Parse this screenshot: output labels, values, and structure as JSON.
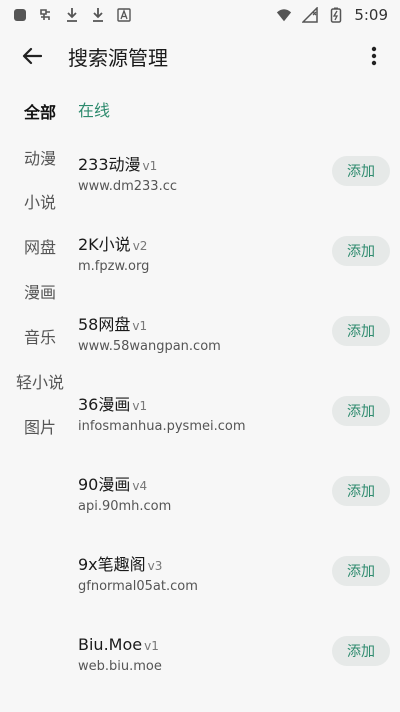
{
  "status_bar": {
    "time": "5:09"
  },
  "header": {
    "title": "搜索源管理"
  },
  "sidebar": {
    "items": [
      {
        "label": "全部",
        "active": true
      },
      {
        "label": "动漫",
        "active": false
      },
      {
        "label": "小说",
        "active": false
      },
      {
        "label": "网盘",
        "active": false
      },
      {
        "label": "漫画",
        "active": false
      },
      {
        "label": "音乐",
        "active": false
      },
      {
        "label": "轻小说",
        "active": false
      },
      {
        "label": "图片",
        "active": false
      }
    ]
  },
  "main": {
    "section_label": "在线",
    "add_label": "添加",
    "sources": [
      {
        "name": "233动漫",
        "version": "v1",
        "url": "www.dm233.cc"
      },
      {
        "name": "2K小说",
        "version": "v2",
        "url": "m.fpzw.org"
      },
      {
        "name": "58网盘",
        "version": "v1",
        "url": "www.58wangpan.com"
      },
      {
        "name": "36漫画",
        "version": "v1",
        "url": "infosmanhua.pysmei.com"
      },
      {
        "name": "90漫画",
        "version": "v4",
        "url": "api.90mh.com"
      },
      {
        "name": "9x笔趣阁",
        "version": "v3",
        "url": "gfnormal05at.com"
      },
      {
        "name": "Biu.Moe",
        "version": "v1",
        "url": "web.biu.moe"
      }
    ]
  },
  "colors": {
    "accent": "#2e8b6e",
    "button_bg": "#e6e9e8",
    "background": "#f7f7f7"
  }
}
